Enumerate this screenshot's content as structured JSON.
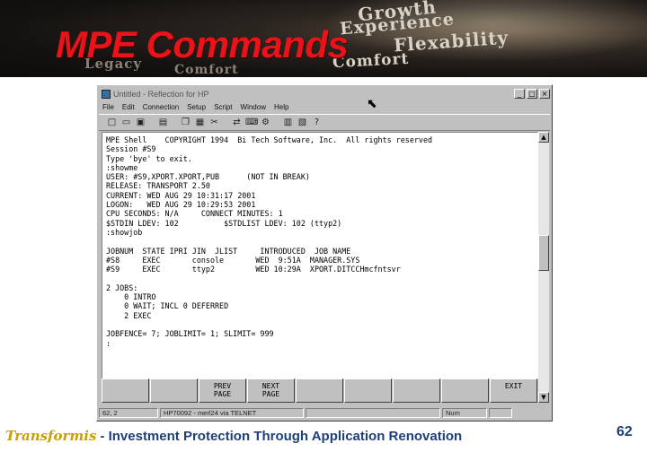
{
  "slide": {
    "title": "MPE Commands",
    "banner_words": [
      "Growth",
      "Experience",
      "Flexability",
      "Comfort",
      "Legacy",
      "Comfort"
    ],
    "footer_logo": "Transformis",
    "footer_text": "- Investment Protection Through Application Renovation",
    "page_number": "62"
  },
  "window": {
    "title": "Untitled - Reflection for HP",
    "controls": [
      "_",
      "□",
      "×"
    ],
    "menus": [
      "File",
      "Edit",
      "Connection",
      "Setup",
      "Script",
      "Window",
      "Help"
    ],
    "toolbar_icons": [
      "new-icon",
      "open-icon",
      "save-icon",
      "print-icon",
      "copy-icon",
      "paste-icon",
      "cut-icon",
      "disconnect-icon",
      "user-keys-icon",
      "setup-icon",
      "function-keys-icon",
      "properties-icon",
      "help-icon"
    ],
    "terminal_lines": [
      "MPE Shell    COPYRIGHT 1994  Bi Tech Software, Inc.  All rights reserved",
      "Session #S9",
      "Type 'bye' to exit.",
      ":showme",
      "USER: #S9,XPORT.XPORT,PUB      (NOT IN BREAK)",
      "RELEASE: TRANSPORT 2.50",
      "CURRENT: WED AUG 29 10:31:17 2001",
      "LOGON:   WED AUG 29 10:29:53 2001",
      "CPU SECONDS: N/A     CONNECT MINUTES: 1",
      "$STDIN LDEV: 102          $STDLIST LDEV: 102 (ttyp2)",
      ":showjob",
      "",
      "JOBNUM  STATE IPRI JIN  JLIST     INTRODUCED  JOB NAME",
      "#S8     EXEC       console       WED  9:51A  MANAGER.SYS",
      "#S9     EXEC       ttyp2         WED 10:29A  XPORT.DITCCHmcfntsvr",
      "",
      "2 JOBS:",
      "    0 INTRO",
      "    0 WAIT; INCL 0 DEFERRED",
      "    2 EXEC",
      "",
      "JOBFENCE= 7; JOBLIMIT= 1; SLIMIT= 999",
      ":"
    ],
    "function_keys": [
      "",
      "",
      "PREV\nPAGE",
      "NEXT\nPAGE",
      "",
      "",
      "",
      "",
      "EXIT"
    ],
    "status": {
      "position": "62, 2",
      "terminal": "HP70092 - merl24 via TELNET",
      "mode": "Num"
    }
  }
}
